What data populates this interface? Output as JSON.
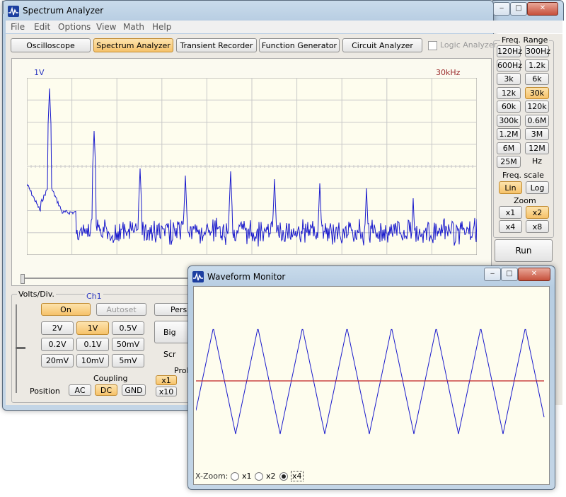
{
  "main_window": {
    "title": "Spectrum Analyzer",
    "menu": [
      "File",
      "Edit",
      "Options",
      "View",
      "Math",
      "Help"
    ],
    "mode_buttons": [
      "Oscilloscope",
      "Spectrum Analyzer",
      "Transient Recorder",
      "Function Generator",
      "Circuit Analyzer"
    ],
    "active_mode": "Spectrum Analyzer",
    "logic_analyzer_label": "Logic Analyzer",
    "plot": {
      "left_label": "1V",
      "right_label": "30kHz"
    },
    "freq_range": {
      "title": "Freq. Range",
      "buttons": [
        "120Hz",
        "300Hz",
        "600Hz",
        "1.2k",
        "3k",
        "6k",
        "12k",
        "30k",
        "60k",
        "120k",
        "300k",
        "0.6M",
        "1.2M",
        "3M",
        "6M",
        "12M",
        "25M",
        "Hz"
      ],
      "active": "30k"
    },
    "freq_scale": {
      "title": "Freq. scale",
      "options": [
        "Lin",
        "Log"
      ],
      "active": "Lin"
    },
    "zoom": {
      "title": "Zoom",
      "options": [
        "x1",
        "x2",
        "x4",
        "x8"
      ],
      "active": "x2"
    },
    "run_label": "Run",
    "volts": {
      "title": "Volts/Div.",
      "channel": "Ch1",
      "on_label": "On",
      "autoset_label": "Autoset",
      "persist_label": "Persi",
      "bigscreen_label": "Big Scr",
      "scales": [
        "2V",
        "1V",
        "0.5V",
        "0.2V",
        "0.1V",
        "50mV",
        "20mV",
        "10mV",
        "5mV"
      ],
      "active_scale": "1V",
      "coupling_title": "Coupling",
      "coupling": [
        "AC",
        "DC",
        "GND"
      ],
      "active_coupling": "DC",
      "position_label": "Position",
      "probe_title": "Prob",
      "probe": [
        "x1",
        "x10"
      ],
      "active_probe": "x1"
    }
  },
  "waveform_window": {
    "title": "Waveform Monitor",
    "xzoom_label": "X-Zoom:",
    "xzoom_options": [
      "x1",
      "x2",
      "x4"
    ],
    "xzoom_selected": "x4"
  },
  "colors": {
    "spectrum_trace": "#1a1acc",
    "triangle_trace": "#1a1acc",
    "flat_trace": "#c02020",
    "active_button": "#f6c26a"
  }
}
